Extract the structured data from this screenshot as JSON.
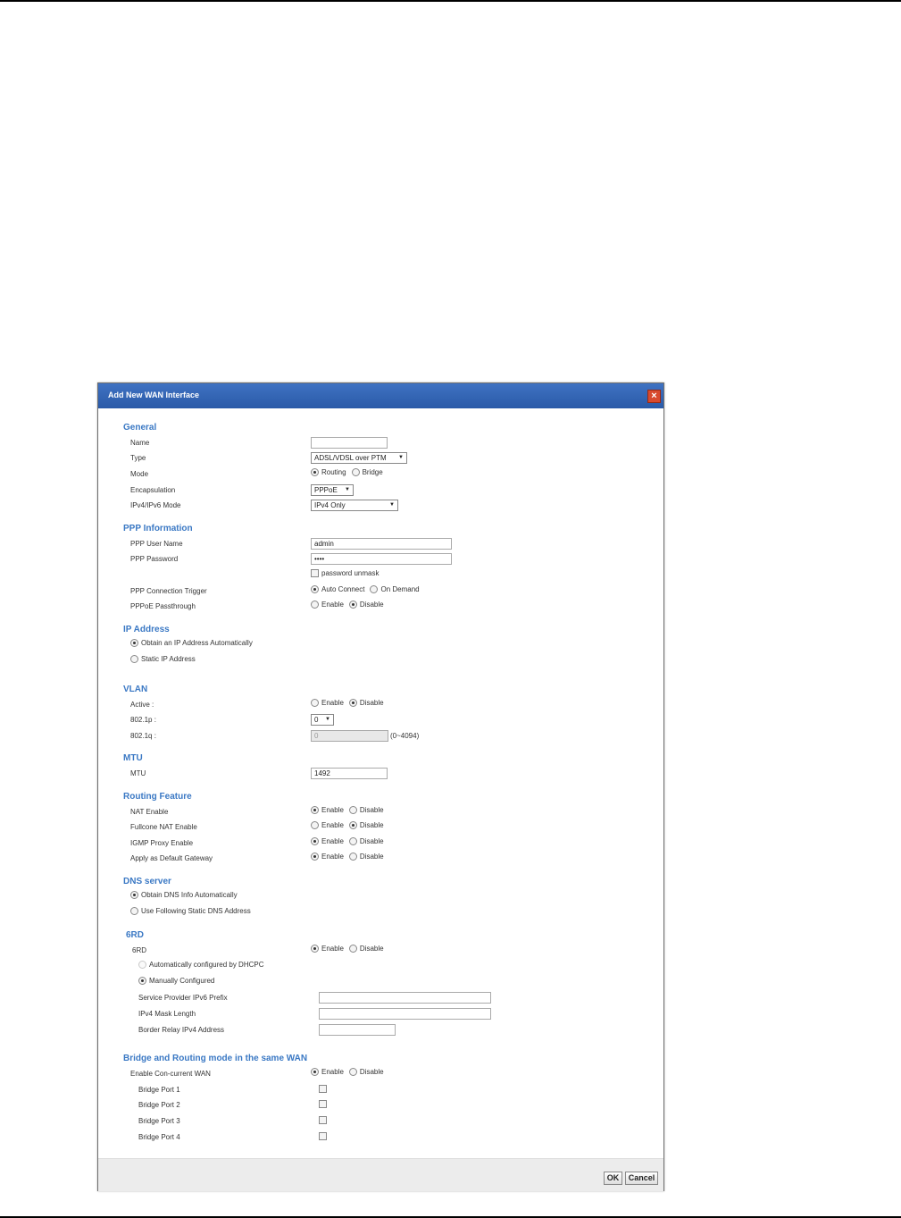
{
  "dialog": {
    "title": "Add New WAN Interface"
  },
  "general": {
    "heading": "General",
    "name_label": "Name",
    "name_value": "",
    "type_label": "Type",
    "type_value": "ADSL/VDSL over PTM",
    "mode_label": "Mode",
    "mode_routing": "Routing",
    "mode_bridge": "Bridge",
    "encap_label": "Encapsulation",
    "encap_value": "PPPoE",
    "ipmode_label": "IPv4/IPv6 Mode",
    "ipmode_value": "IPv4 Only"
  },
  "ppp": {
    "heading": "PPP Information",
    "user_label": "PPP User Name",
    "user_value": "admin",
    "pass_label": "PPP Password",
    "pass_value": "••••",
    "unmask_label": "password unmask",
    "trigger_label": "PPP Connection Trigger",
    "trigger_auto": "Auto Connect",
    "trigger_demand": "On Demand",
    "passthrough_label": "PPPoE Passthrough",
    "enable": "Enable",
    "disable": "Disable"
  },
  "ip": {
    "heading": "IP Address",
    "auto": "Obtain an IP Address Automatically",
    "static": "Static IP Address"
  },
  "vlan": {
    "heading": "VLAN",
    "active_label": "Active :",
    "p_label": "802.1p :",
    "p_value": "0",
    "q_label": "802.1q :",
    "q_value": "0",
    "q_range": "(0~4094)",
    "enable": "Enable",
    "disable": "Disable"
  },
  "mtu": {
    "heading": "MTU",
    "label": "MTU",
    "value": "1492"
  },
  "routing": {
    "heading": "Routing Feature",
    "nat_label": "NAT Enable",
    "fullcone_label": "Fullcone NAT Enable",
    "igmp_label": "IGMP Proxy Enable",
    "gateway_label": "Apply as Default Gateway",
    "enable": "Enable",
    "disable": "Disable"
  },
  "dns": {
    "heading": "DNS server",
    "auto": "Obtain DNS Info Automatically",
    "static": "Use Following Static DNS Address"
  },
  "sixrd": {
    "heading": "6RD",
    "label": "6RD",
    "enable": "Enable",
    "disable": "Disable",
    "auto_dhcpc": "Automatically configured by DHCPC",
    "manual": "Manually Configured",
    "prefix_label": "Service Provider IPv6 Prefix",
    "mask_label": "IPv4 Mask Length",
    "relay_label": "Border Relay IPv4 Address"
  },
  "bridge": {
    "heading": "Bridge and Routing mode in the same WAN",
    "concurrent_label": "Enable Con-current WAN",
    "enable": "Enable",
    "disable": "Disable",
    "port1": "Bridge Port 1",
    "port2": "Bridge Port 2",
    "port3": "Bridge Port 3",
    "port4": "Bridge Port 4"
  },
  "footer": {
    "ok": "OK",
    "cancel": "Cancel"
  }
}
